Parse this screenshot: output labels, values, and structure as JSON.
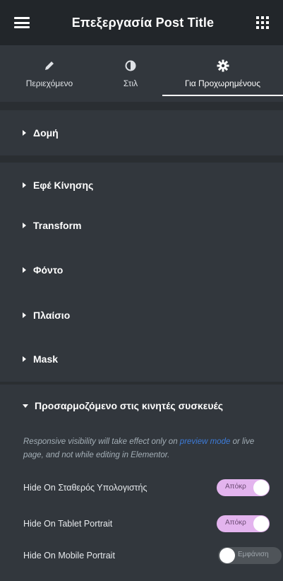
{
  "header": {
    "title": "Επεξεργασία Post Title",
    "menu_icon": "hamburger-icon",
    "apps_icon": "grid-icon"
  },
  "tabs": [
    {
      "label": "Περιεχόμενο",
      "icon": "pencil-icon",
      "active": false
    },
    {
      "label": "Στιλ",
      "icon": "half-circle-icon",
      "active": false
    },
    {
      "label": "Για Προχωρημένους",
      "icon": "gear-icon",
      "active": true
    }
  ],
  "sections": [
    {
      "label": "Δομή",
      "expanded": false
    },
    {
      "label": "Εφέ Κίνησης",
      "expanded": false
    },
    {
      "label": "Transform",
      "expanded": false
    },
    {
      "label": "Φόντο",
      "expanded": false
    },
    {
      "label": "Πλαίσιο",
      "expanded": false
    },
    {
      "label": "Mask",
      "expanded": false
    },
    {
      "label": "Προσαρμοζόμενο στις κινητές συσκευές",
      "expanded": true
    }
  ],
  "responsive": {
    "note_before": "Responsive visibility will take effect only on ",
    "note_link": "preview mode",
    "note_after": " or live page, and not while editing in Elementor.",
    "controls": [
      {
        "label": "Hide On Σταθερός Υπολογιστής",
        "toggle_text": "Απόκρ",
        "on": true
      },
      {
        "label": "Hide On Tablet Portrait",
        "toggle_text": "Απόκρ",
        "on": true
      },
      {
        "label": "Hide On Mobile Portrait",
        "toggle_text": "Εμφάνιση",
        "on": false
      }
    ]
  },
  "colors": {
    "header_bg": "#22262a",
    "panel_bg": "#32373d",
    "toggle_on": "#e3b4ee",
    "toggle_off": "#4f5459",
    "link": "#3d7bd8"
  }
}
